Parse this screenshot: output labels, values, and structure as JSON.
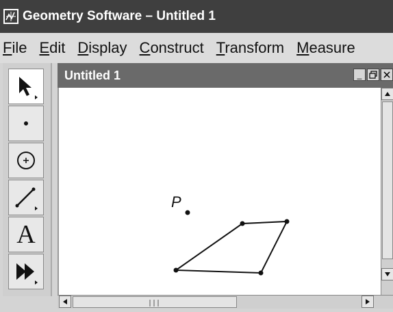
{
  "app": {
    "title": "Geometry Software – Untitled 1"
  },
  "menu": {
    "items": [
      {
        "mnemonic": "F",
        "rest": "ile"
      },
      {
        "mnemonic": "E",
        "rest": "dit"
      },
      {
        "mnemonic": "D",
        "rest": "isplay"
      },
      {
        "mnemonic": "C",
        "rest": "onstruct"
      },
      {
        "mnemonic": "T",
        "rest": "ransform"
      },
      {
        "mnemonic": "M",
        "rest": "easure"
      }
    ]
  },
  "toolbox": {
    "tools": [
      {
        "name": "arrow-tool",
        "icon": "arrow-icon",
        "active": true
      },
      {
        "name": "point-tool",
        "icon": "point-icon"
      },
      {
        "name": "compass-tool",
        "icon": "circle-icon"
      },
      {
        "name": "straightedge-tool",
        "icon": "segment-icon"
      },
      {
        "name": "text-tool",
        "icon": "text-icon",
        "label": "A"
      },
      {
        "name": "custom-tool",
        "icon": "double-arrow-icon"
      }
    ]
  },
  "document": {
    "title": "Untitled 1",
    "point_label": "P"
  },
  "colors": {
    "title_bar": "#3f3f3f",
    "doc_title_bar": "#6a6a6a",
    "canvas": "#ffffff"
  }
}
